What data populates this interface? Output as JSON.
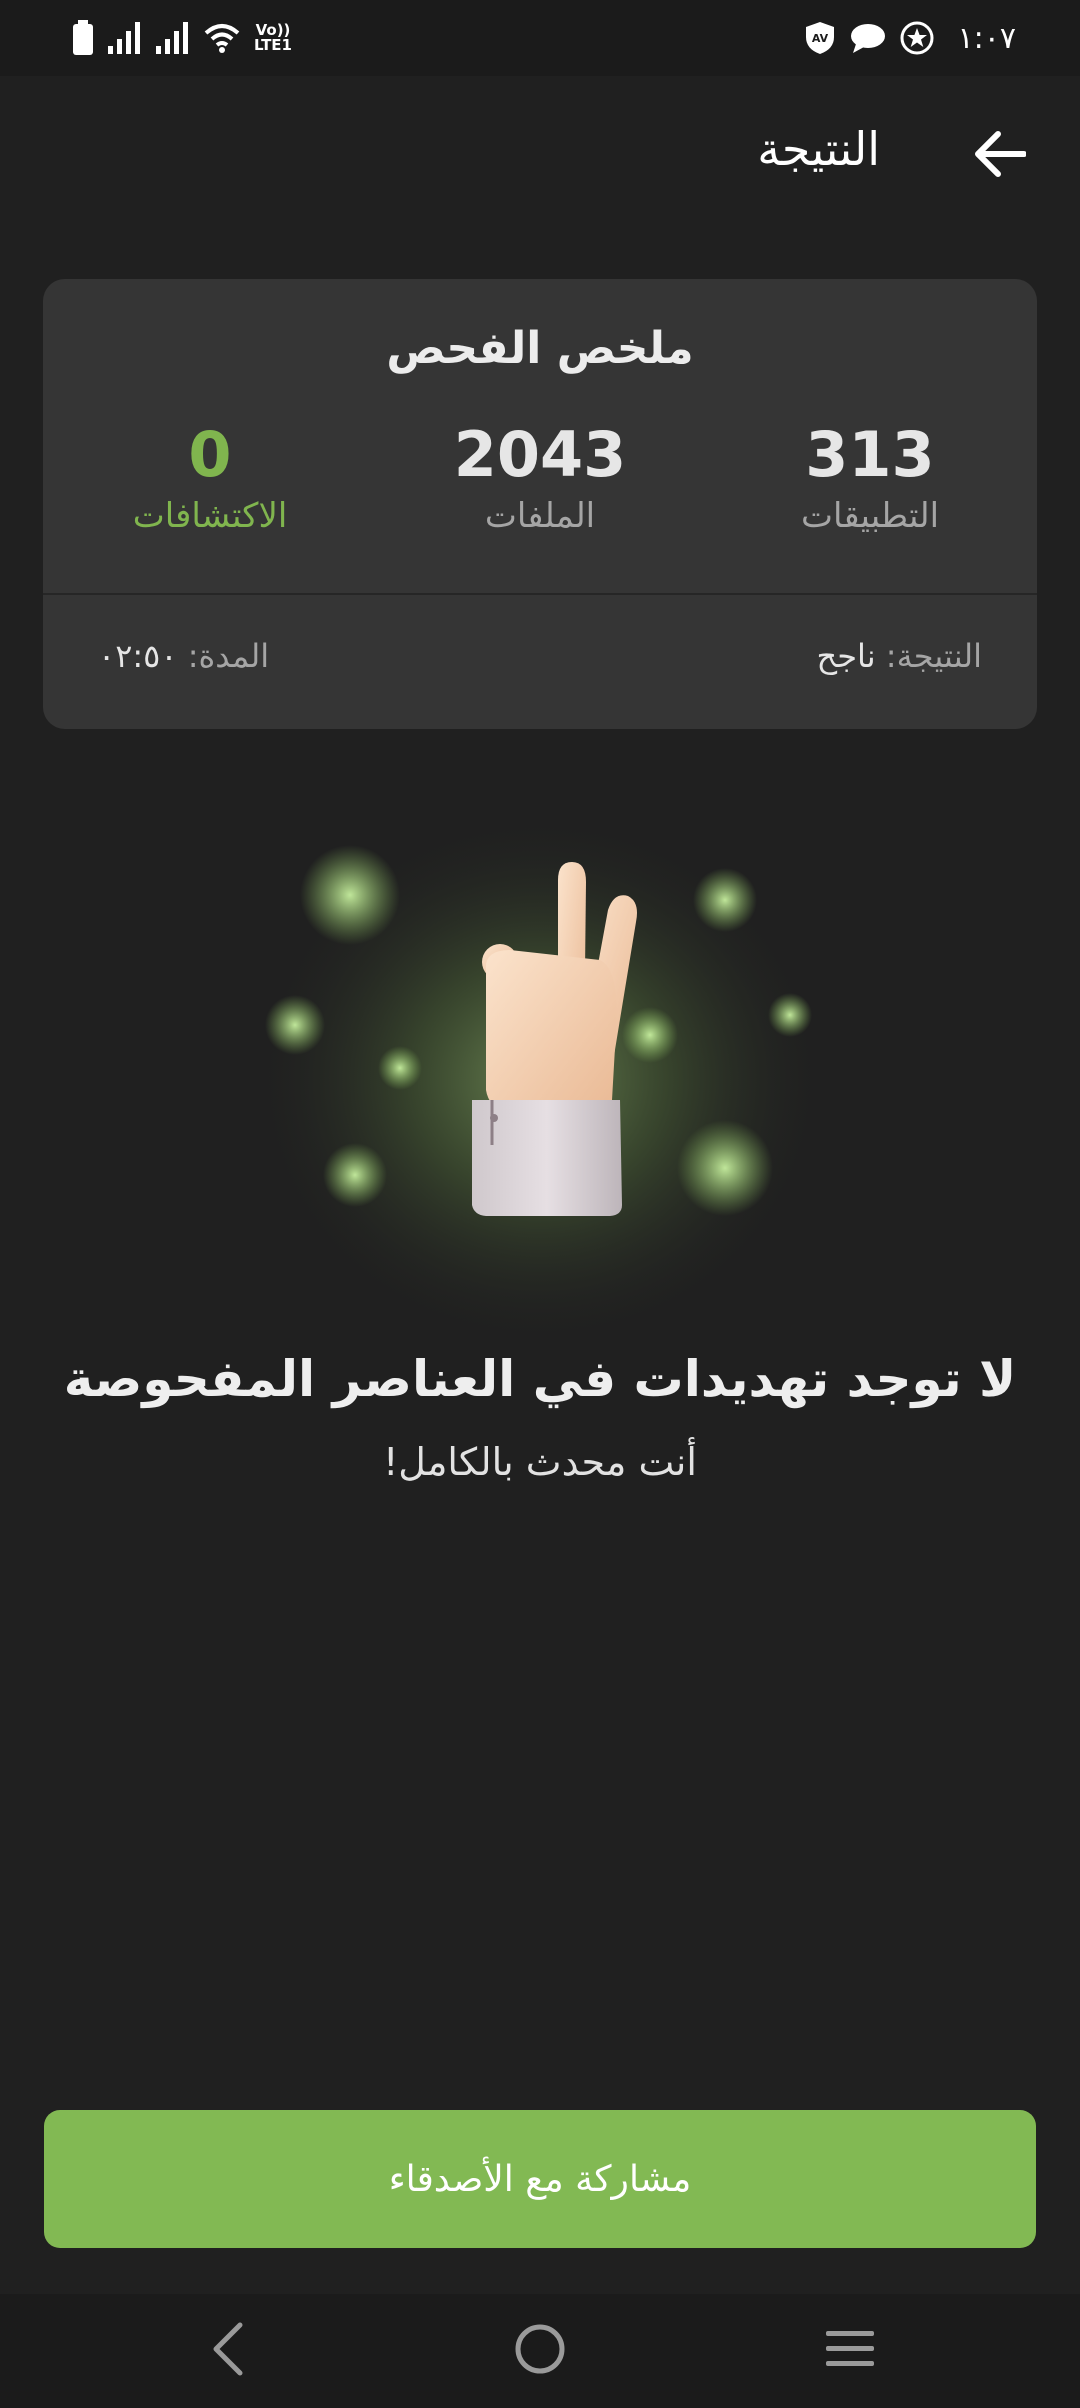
{
  "status_bar": {
    "time": "١:٠٧",
    "network_tag_top": "Vo))",
    "network_tag_bottom": "LTE1",
    "left_icons": [
      "battery-icon",
      "signal-icon",
      "signal-icon",
      "wifi-icon"
    ],
    "right_icons": [
      "av-shield-icon",
      "chat-bubble-icon",
      "star-circle-icon"
    ]
  },
  "header": {
    "title": "النتيجة",
    "back_icon": "arrow-back-icon"
  },
  "summary": {
    "title": "ملخص الفحص",
    "stats": {
      "apps": {
        "value": "313",
        "label": "التطبيقات"
      },
      "files": {
        "value": "2043",
        "label": "الملفات"
      },
      "detections": {
        "value": "0",
        "label": "الاكتشافات"
      }
    },
    "result_label": "النتيجة:",
    "result_value": "ناجح",
    "duration_label": "المدة:",
    "duration_value": "٠٢:٥٠"
  },
  "illustration": {
    "icon": "victory-hand-icon"
  },
  "message": {
    "headline": "لا توجد تهديدات في العناصر المفحوصة",
    "subline": "أنت محدث بالكامل!"
  },
  "share": {
    "label": "مشاركة مع الأصدقاء"
  },
  "colors": {
    "background": "#202020",
    "card": "#353535",
    "accent_green": "#82b953",
    "detections_green": "#80b54e"
  },
  "nav": {
    "icons": [
      "nav-back-icon",
      "nav-home-icon",
      "nav-menu-icon"
    ]
  }
}
